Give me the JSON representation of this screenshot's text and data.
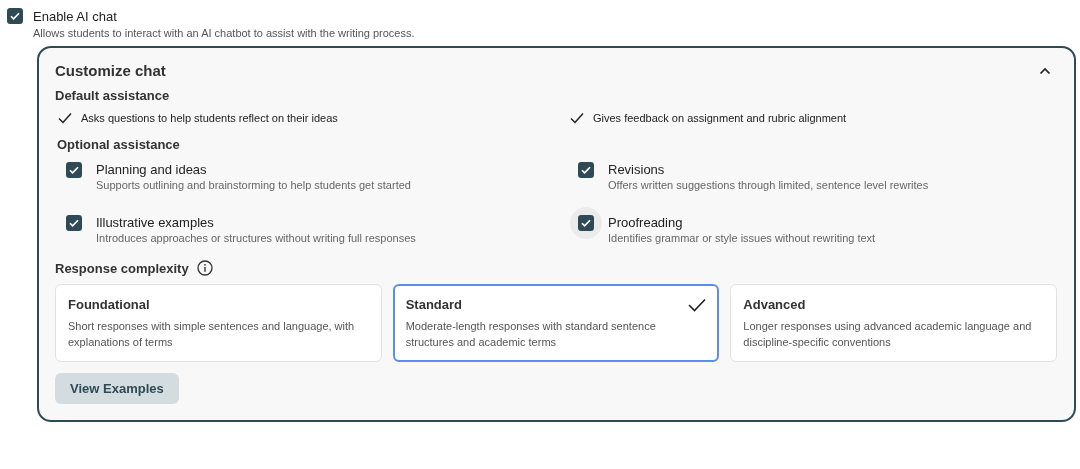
{
  "enable": {
    "label": "Enable AI chat",
    "description": "Allows students to interact with an AI chatbot to assist with the writing process.",
    "checked": true
  },
  "panel": {
    "title": "Customize chat",
    "expanded": true,
    "default_assistance": {
      "heading": "Default assistance",
      "items": [
        {
          "label": "Asks questions to help students reflect on their ideas"
        },
        {
          "label": "Gives feedback on assignment and rubric alignment"
        }
      ]
    },
    "optional_assistance": {
      "heading": "Optional assistance",
      "items": [
        {
          "label": "Planning and ideas",
          "description": "Supports outlining and brainstorming to help students get started",
          "checked": true,
          "hovered": false
        },
        {
          "label": "Revisions",
          "description": "Offers written suggestions through limited, sentence level rewrites",
          "checked": true,
          "hovered": false
        },
        {
          "label": "Illustrative examples",
          "description": "Introduces approaches or structures without writing full responses",
          "checked": true,
          "hovered": false
        },
        {
          "label": "Proofreading",
          "description": "Identifies grammar or style issues without rewriting text",
          "checked": true,
          "hovered": true
        }
      ]
    },
    "response_complexity": {
      "heading": "Response complexity",
      "options": [
        {
          "title": "Foundational",
          "description": "Short responses with simple sentences and language, with explanations of terms",
          "selected": false
        },
        {
          "title": "Standard",
          "description": "Moderate-length responses with standard sentence structures and academic terms",
          "selected": true
        },
        {
          "title": "Advanced",
          "description": "Longer responses using advanced academic language and discipline-specific conventions",
          "selected": false
        }
      ]
    },
    "button": "View Examples"
  }
}
